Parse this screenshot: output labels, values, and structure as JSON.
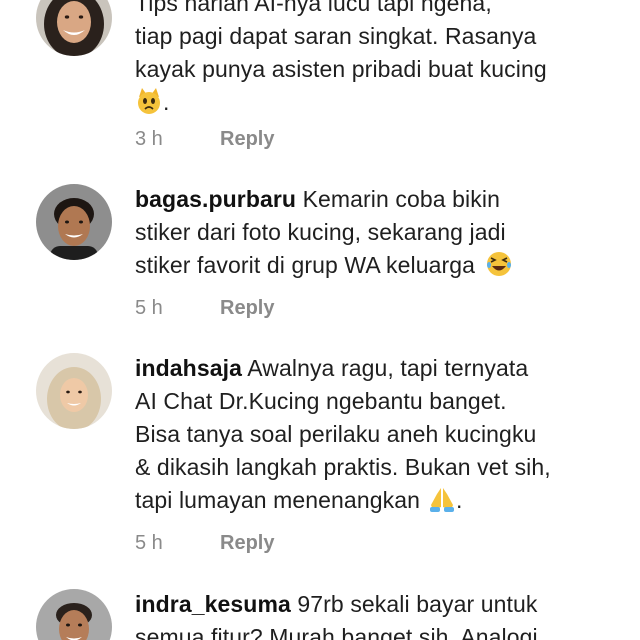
{
  "comments": [
    {
      "username": "",
      "lines": [
        "Tips harian AI-nya lucu tapi ngena,",
        "tiap pagi dapat saran singkat. Rasanya",
        "kayak punya asisten pribadi buat kucing"
      ],
      "trailing": ".",
      "emoji_icon": "cat-emoji-icon",
      "time": "3 h",
      "reply_label": "Reply"
    },
    {
      "username": "bagas.purbaru",
      "lines": [
        "Kemarin coba bikin",
        "stiker dari foto kucing, sekarang jadi",
        "stiker favorit di grup WA keluarga"
      ],
      "trailing": "",
      "emoji_icon": "laughing-emoji-icon",
      "time": "5 h",
      "reply_label": "Reply"
    },
    {
      "username": "indahsaja",
      "lines": [
        "Awalnya ragu, tapi ternyata",
        "AI Chat Dr.Kucing ngebantu banget.",
        "Bisa tanya soal perilaku aneh kucingku",
        "& dikasih langkah praktis. Bukan vet sih,",
        "tapi lumayan menenangkan"
      ],
      "trailing": ".",
      "emoji_icon": "folded-hands-emoji-icon",
      "time": "5 h",
      "reply_label": "Reply"
    },
    {
      "username": "indra_kesuma",
      "lines": [
        "97rb sekali bayar untuk",
        "semua fitur? Murah banget sih. Analogi"
      ],
      "trailing": "",
      "emoji_icon": "",
      "time": "",
      "reply_label": ""
    }
  ]
}
